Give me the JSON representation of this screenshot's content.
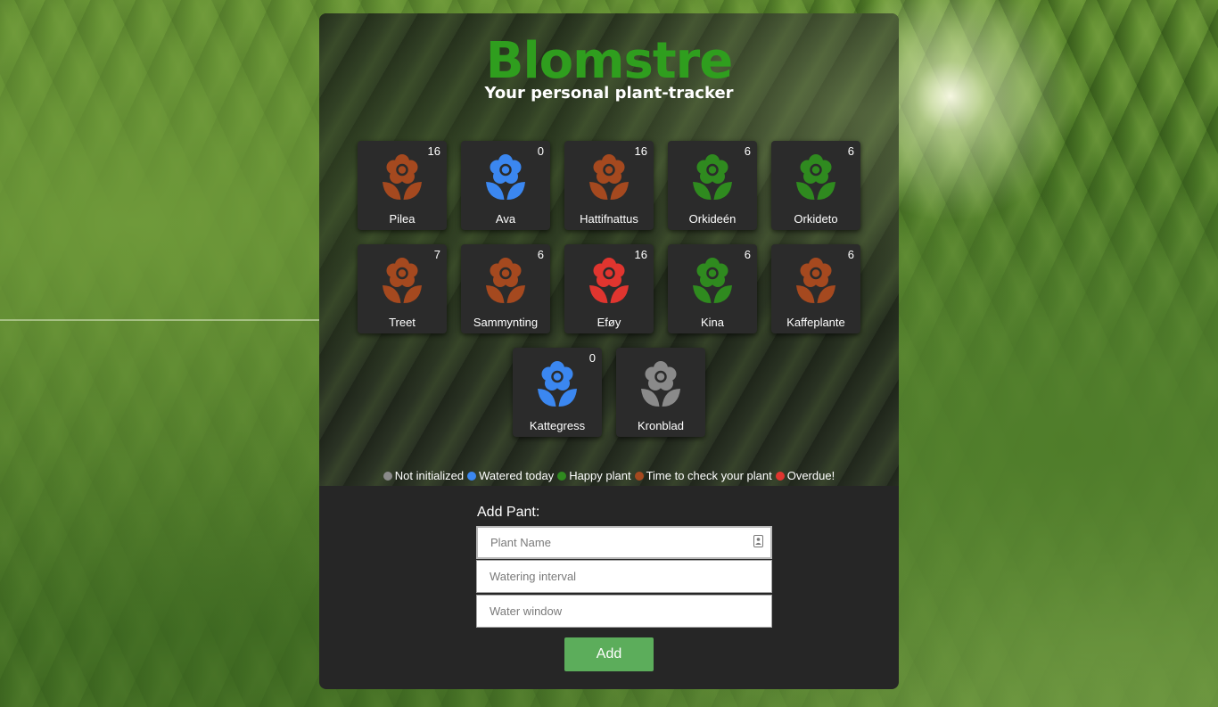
{
  "app": {
    "title": "Blomstre",
    "subtitle": "Your personal plant-tracker"
  },
  "status_colors": {
    "not_initialized": "#8a8a8a",
    "watered_today": "#3b87f0",
    "happy": "#2f8a1f",
    "check": "#a5491f",
    "overdue": "#e0352f"
  },
  "plants": [
    {
      "name": "Pilea",
      "count": "16",
      "status": "check",
      "icon": "flower-icon"
    },
    {
      "name": "Ava",
      "count": "0",
      "status": "watered_today",
      "icon": "flower-icon"
    },
    {
      "name": "Hattifnattus",
      "count": "16",
      "status": "check",
      "icon": "flower-icon"
    },
    {
      "name": "Orkideén",
      "count": "6",
      "status": "happy",
      "icon": "flower-icon"
    },
    {
      "name": "Orkideto",
      "count": "6",
      "status": "happy",
      "icon": "flower-icon"
    },
    {
      "name": "Treet",
      "count": "7",
      "status": "check",
      "icon": "flower-icon"
    },
    {
      "name": "Sammynting",
      "count": "6",
      "status": "check",
      "icon": "flower-icon"
    },
    {
      "name": "Eføy",
      "count": "16",
      "status": "overdue",
      "icon": "flower-icon"
    },
    {
      "name": "Kina",
      "count": "6",
      "status": "happy",
      "icon": "flower-icon"
    },
    {
      "name": "Kaffeplante",
      "count": "6",
      "status": "check",
      "icon": "flower-icon"
    },
    {
      "name": "Kattegress",
      "count": "0",
      "status": "watered_today",
      "icon": "flower-icon"
    },
    {
      "name": "Kronblad",
      "count": "",
      "status": "not_initialized",
      "icon": "flower-icon"
    }
  ],
  "legend": [
    {
      "label": "Not initialized",
      "status": "not_initialized"
    },
    {
      "label": "Watered today",
      "status": "watered_today"
    },
    {
      "label": "Happy plant",
      "status": "happy"
    },
    {
      "label": "Time to check your plant",
      "status": "check"
    },
    {
      "label": "Overdue!",
      "status": "overdue"
    }
  ],
  "form": {
    "label": "Add Pant:",
    "name_placeholder": "Plant Name",
    "interval_placeholder": "Watering interval",
    "window_placeholder": "Water window",
    "add_label": "Add",
    "add_color": "#5cad5b"
  }
}
